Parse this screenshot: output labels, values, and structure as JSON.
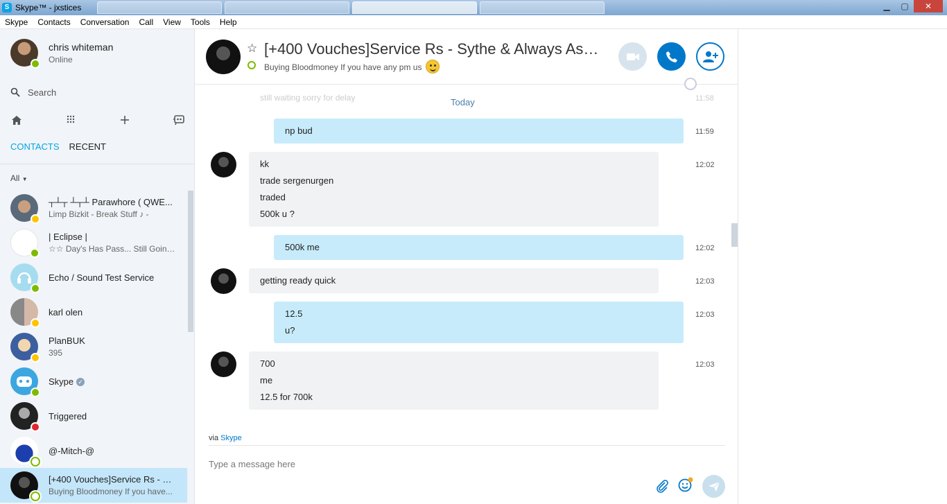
{
  "window": {
    "title": "Skype™ - jxstices",
    "app_icon": "S"
  },
  "menu": {
    "items": [
      "Skype",
      "Contacts",
      "Conversation",
      "Call",
      "View",
      "Tools",
      "Help"
    ]
  },
  "profile": {
    "name": "chris whiteman",
    "status": "Online"
  },
  "search": {
    "label": "Search"
  },
  "tabs": {
    "contacts": "CONTACTS",
    "recent": "RECENT"
  },
  "filter": {
    "label": "All"
  },
  "contacts": [
    {
      "name": "┬┴┬ ┴┬┴ Parawhore ( QWE...",
      "mood": "Limp Bizkit - Break Stuff ♪ -",
      "status": "away"
    },
    {
      "name": "| Eclipse |",
      "mood": "☆☆ Day's Has Pass... Still Going...",
      "status": "online"
    },
    {
      "name": "Echo / Sound Test Service",
      "mood": "",
      "status": "online"
    },
    {
      "name": "karl olen",
      "mood": "",
      "status": "away"
    },
    {
      "name": "PlanBUK",
      "mood": "395",
      "status": "away"
    },
    {
      "name": "Skype",
      "mood": "",
      "status": "online",
      "verified": "✓"
    },
    {
      "name": "Triggered",
      "mood": "",
      "status": "dnd"
    },
    {
      "name": "@-Mitch-@",
      "mood": "",
      "status": "offline"
    },
    {
      "name": "[+400 Vouches]Service Rs - Sy...",
      "mood": "Buying Bloodmoney If you have...",
      "status": "offline"
    }
  ],
  "chat": {
    "title": "[+400 Vouches]Service Rs - Sythe & Always Ask Fo...",
    "mood": "Buying Bloodmoney If you have any pm us",
    "star_icon": "☆"
  },
  "messages": {
    "faded_text": "still waiting sorry for delay",
    "faded_time": "11:58",
    "today_label": "Today",
    "items": [
      {
        "direction": "out",
        "lines": [
          "np bud"
        ],
        "time": "11:59"
      },
      {
        "direction": "in",
        "lines": [
          "kk",
          "trade sergenurgen",
          "traded",
          "500k u ?"
        ],
        "time": "12:02"
      },
      {
        "direction": "out",
        "lines": [
          "500k me"
        ],
        "time": "12:02"
      },
      {
        "direction": "in",
        "lines": [
          "getting ready quick"
        ],
        "time": "12:03"
      },
      {
        "direction": "out",
        "lines": [
          "12.5",
          "u?"
        ],
        "time": "12:03"
      },
      {
        "direction": "in",
        "lines": [
          "700",
          "me",
          "12.5 for 700k"
        ],
        "time": "12:03"
      }
    ]
  },
  "composer": {
    "via_prefix": "via",
    "via_link": "Skype",
    "placeholder": "Type a message here"
  },
  "colors": {
    "accent": "#00a7e4",
    "call_button": "#0078ca",
    "outgoing_bubble": "#c7ebfb",
    "incoming_bubble": "#f0f2f4",
    "selected_contact": "#c3e6fa"
  }
}
